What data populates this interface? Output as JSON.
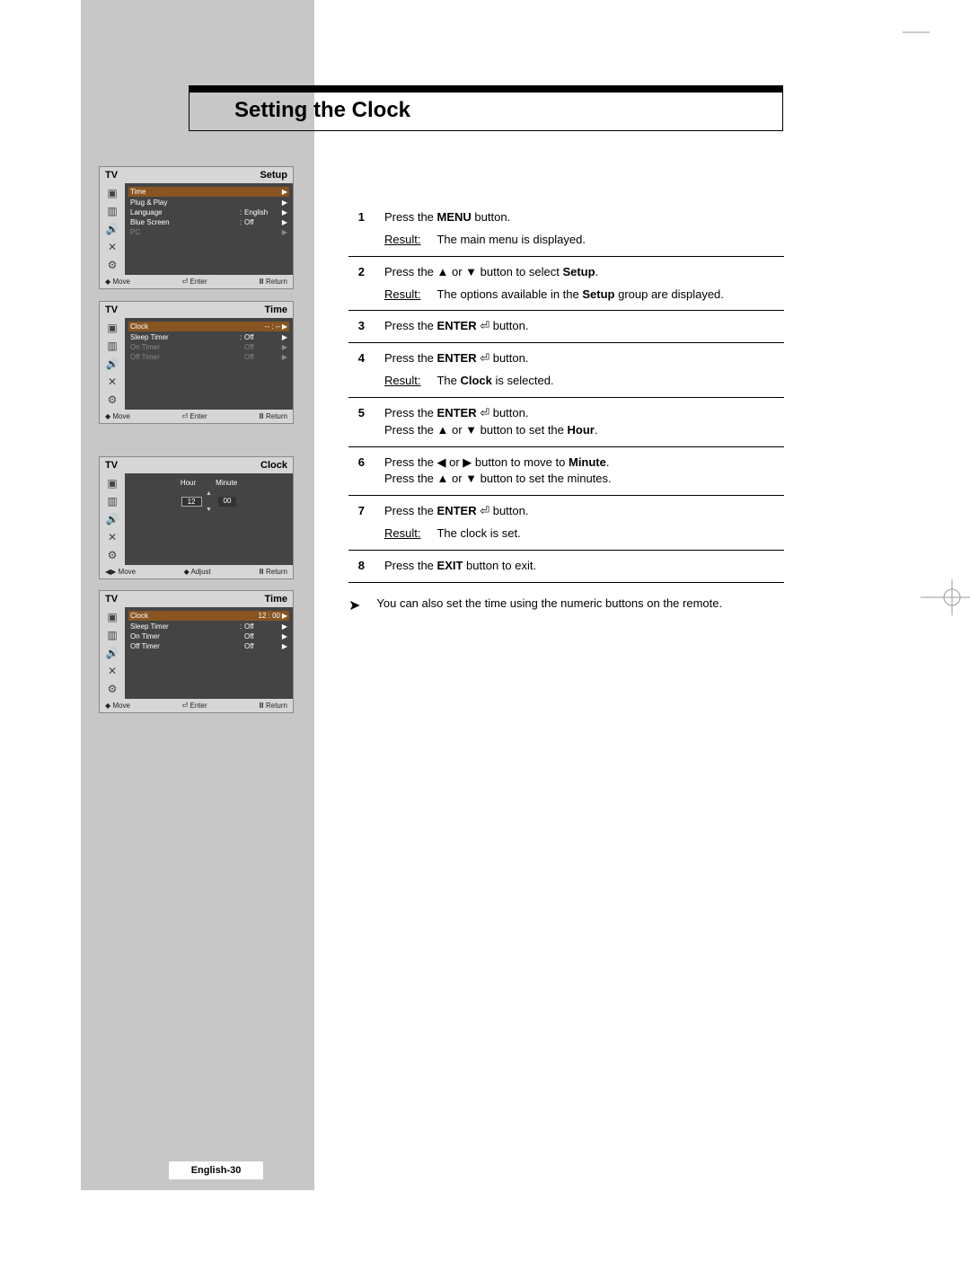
{
  "title": "Setting the Clock",
  "page_label": "English-30",
  "osd_common": {
    "tv": "TV",
    "move": "Move",
    "enter": "Enter",
    "return": "Return",
    "adjust": "Adjust"
  },
  "osd": [
    {
      "title": "Setup",
      "selected": "Time",
      "rows": [
        {
          "l": "Plug & Play",
          "c": "",
          "v": "",
          "ar": "▶",
          "dim": false
        },
        {
          "l": "Language",
          "c": ":",
          "v": "English",
          "ar": "▶",
          "dim": false
        },
        {
          "l": "Blue Screen",
          "c": ":",
          "v": "Off",
          "ar": "▶",
          "dim": false
        },
        {
          "l": "PC",
          "c": "",
          "v": "",
          "ar": "▶",
          "dim": true
        }
      ],
      "hints": [
        "move",
        "enter",
        "return"
      ]
    },
    {
      "title": "Time",
      "selected": "Clock",
      "sel_value": "-- : --",
      "rows": [
        {
          "l": "Sleep Timer",
          "c": ":",
          "v": "Off",
          "ar": "▶",
          "dim": false
        },
        {
          "l": "On Timer",
          "c": "",
          "v": "Off",
          "ar": "▶",
          "dim": true
        },
        {
          "l": "Off Timer",
          "c": "",
          "v": "Off",
          "ar": "▶",
          "dim": true
        }
      ],
      "hints": [
        "move",
        "enter",
        "return"
      ]
    },
    {
      "title": "Clock",
      "hour_label": "Hour",
      "minute_label": "Minute",
      "hour_value": "12",
      "minute_value": "00",
      "hints": [
        "move",
        "adjust",
        "return"
      ]
    },
    {
      "title": "Time",
      "selected": "Clock",
      "sel_value": "12 : 00",
      "rows": [
        {
          "l": "Sleep Timer",
          "c": ":",
          "v": "Off",
          "ar": "▶",
          "dim": false
        },
        {
          "l": "On Timer",
          "c": "",
          "v": "Off",
          "ar": "▶",
          "dim": false
        },
        {
          "l": "Off Timer",
          "c": "",
          "v": "Off",
          "ar": "▶",
          "dim": false
        }
      ],
      "hints": [
        "move",
        "enter",
        "return"
      ]
    }
  ],
  "steps": [
    {
      "n": "1",
      "lines": [
        [
          "Press the ",
          "MENU",
          " button."
        ]
      ],
      "result": "The main menu is displayed."
    },
    {
      "n": "2",
      "lines": [
        [
          "Press the ▲ or ▼ button to select ",
          "Setup",
          "."
        ]
      ],
      "result_parts": [
        "The options available in the ",
        "Setup",
        " group are displayed."
      ]
    },
    {
      "n": "3",
      "lines": [
        [
          "Press the ",
          "ENTER",
          " ⏎ button."
        ]
      ]
    },
    {
      "n": "4",
      "lines": [
        [
          "Press the ",
          "ENTER",
          " ⏎ button."
        ]
      ],
      "result_parts": [
        "The ",
        "Clock",
        " is selected."
      ]
    },
    {
      "n": "5",
      "lines": [
        [
          "Press the ",
          "ENTER",
          " ⏎ button."
        ],
        [
          "Press the ▲ or ▼ button to set the ",
          "Hour",
          "."
        ]
      ]
    },
    {
      "n": "6",
      "lines": [
        [
          "Press the ◀ or ▶ button to move to ",
          "Minute",
          "."
        ],
        [
          "Press the ▲ or ▼ button to set the minutes.",
          "",
          ""
        ]
      ]
    },
    {
      "n": "7",
      "lines": [
        [
          "Press the ",
          "ENTER",
          " ⏎ button."
        ]
      ],
      "result": "The clock is set."
    },
    {
      "n": "8",
      "lines": [
        [
          "Press the ",
          "EXIT",
          " button to exit."
        ]
      ]
    }
  ],
  "note": "You can also set the time using the numeric buttons on the remote.",
  "result_label": "Result:"
}
